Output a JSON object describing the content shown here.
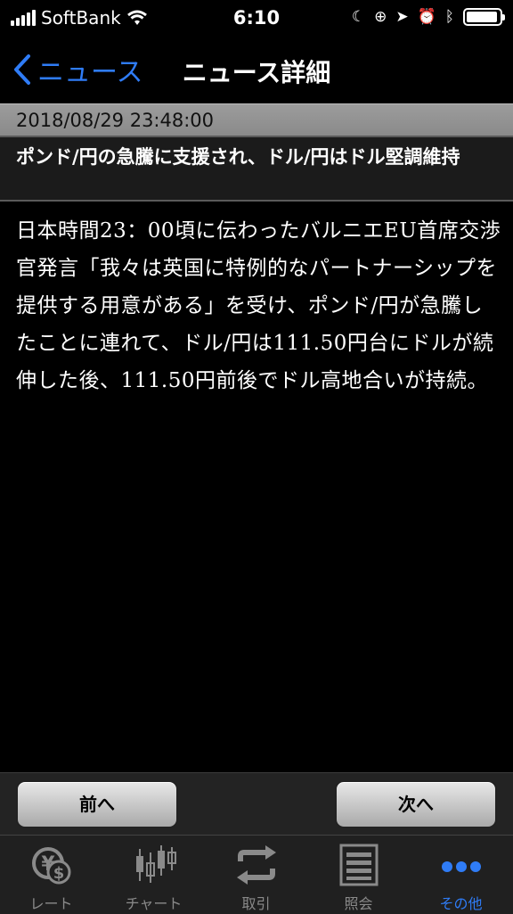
{
  "status": {
    "carrier": "SoftBank",
    "time": "6:10"
  },
  "nav": {
    "back_label": "ニュース",
    "title": "ニュース詳細"
  },
  "article": {
    "datetime": "2018/08/29 23:48:00",
    "headline": "ポンド/円の急騰に支援され、ドル/円はドル堅調維持",
    "body": "日本時間23：00頃に伝わったバルニエEU首席交渉官発言「我々は英国に特例的なパートナーシップを提供する用意がある」を受け、ポンド/円が急騰したことに連れて、ドル/円は111.50円台にドルが続伸した後、111.50円前後でドル高地合いが持続。"
  },
  "pager": {
    "prev_label": "前へ",
    "next_label": "次へ"
  },
  "tabs": [
    {
      "label": "レート",
      "icon": "yen-dollar-icon"
    },
    {
      "label": "チャート",
      "icon": "candlestick-chart-icon"
    },
    {
      "label": "取引",
      "icon": "exchange-arrows-icon"
    },
    {
      "label": "照会",
      "icon": "list-document-icon"
    },
    {
      "label": "その他",
      "icon": "more-dots-icon"
    }
  ],
  "colors": {
    "accent": "#2f7cf6",
    "inactive": "#8a8a8a"
  }
}
